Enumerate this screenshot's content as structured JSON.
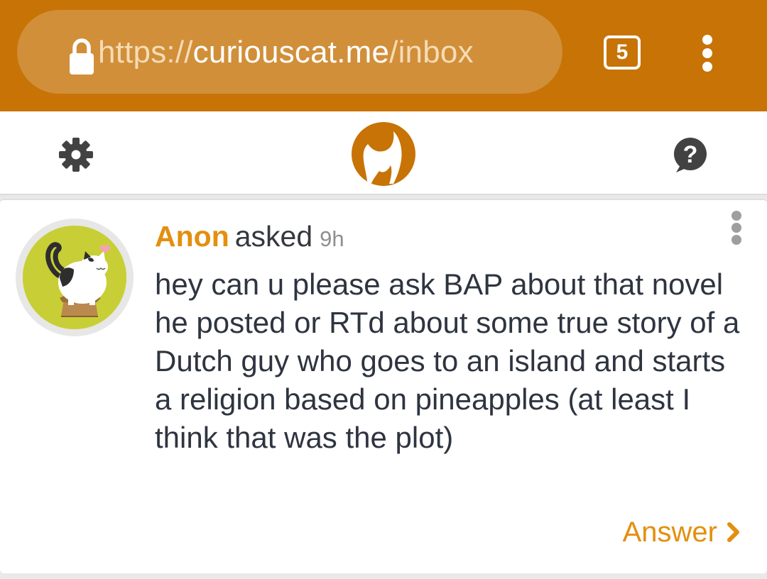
{
  "browser": {
    "url_scheme": "https://",
    "url_host": "curiouscat.me",
    "url_path": "/inbox",
    "tab_count": "5"
  },
  "app": {
    "icons": [
      "gear-icon",
      "curiouscat-logo",
      "help-icon"
    ]
  },
  "question": {
    "asker": "Anon",
    "verb": "asked",
    "time": "9h",
    "text": "hey can u please ask BAP about that novel he posted or RTd about some true story of a Dutch guy who goes to an island and starts a religion based on pineapples (at least I think that was the plot)",
    "answer_label": "Answer"
  },
  "colors": {
    "browser_bar": "#c77306",
    "accent": "#e38f0f",
    "avatar_bg": "#c8cf36"
  }
}
